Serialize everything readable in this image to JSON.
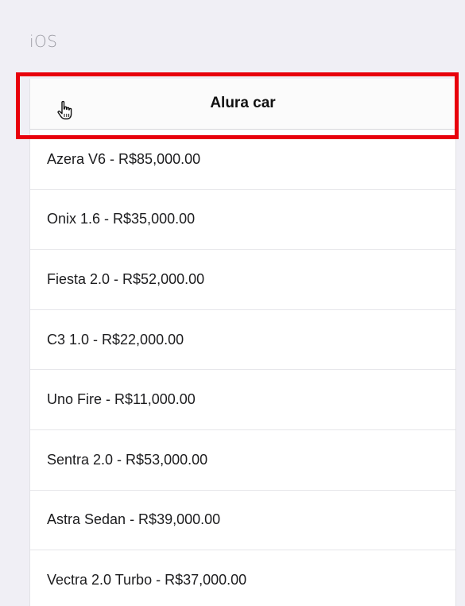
{
  "platform": {
    "label": "iOS"
  },
  "navbar": {
    "title": "Alura car"
  },
  "cars": [
    "Azera V6 - R$85,000.00",
    "Onix 1.6 - R$35,000.00",
    "Fiesta 2.0 - R$52,000.00",
    "C3 1.0 - R$22,000.00",
    "Uno Fire - R$11,000.00",
    "Sentra 2.0 - R$53,000.00",
    "Astra Sedan - R$39,000.00",
    "Vectra 2.0 Turbo - R$37,000.00"
  ],
  "colors": {
    "highlight": "#e8000b",
    "background": "#f0eff5"
  },
  "icons": {
    "cursor": "hand-pointer-icon"
  }
}
